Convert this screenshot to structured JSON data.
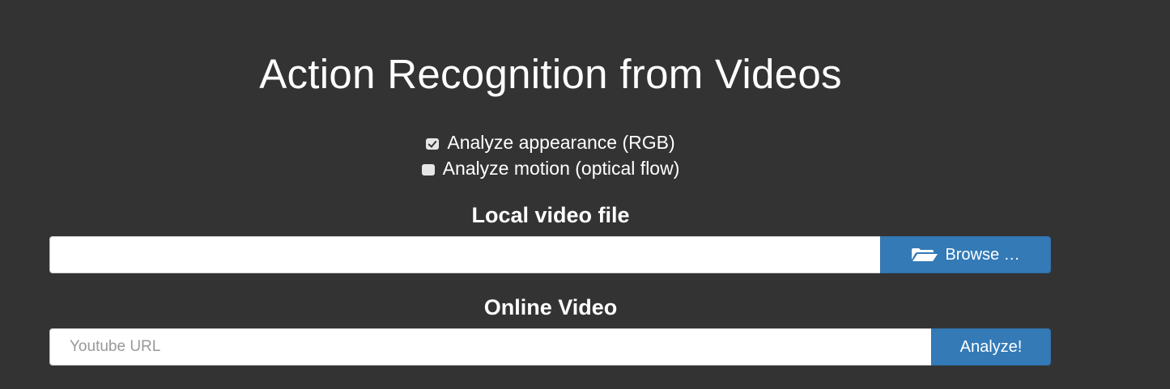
{
  "header": {
    "title": "Action Recognition from Videos"
  },
  "options": {
    "rgb": {
      "label": "Analyze appearance (RGB)",
      "checked": true
    },
    "flow": {
      "label": "Analyze motion (optical flow)",
      "checked": false
    }
  },
  "local_video": {
    "label": "Local video file",
    "value": "",
    "browse_label": "Browse …",
    "browse_icon": "folder-open-icon"
  },
  "online_video": {
    "label": "Online Video",
    "placeholder": "Youtube URL",
    "value": "",
    "analyze_label": "Analyze!"
  },
  "colors": {
    "background": "#333333",
    "primary": "#337ab7",
    "text": "#ffffff"
  }
}
